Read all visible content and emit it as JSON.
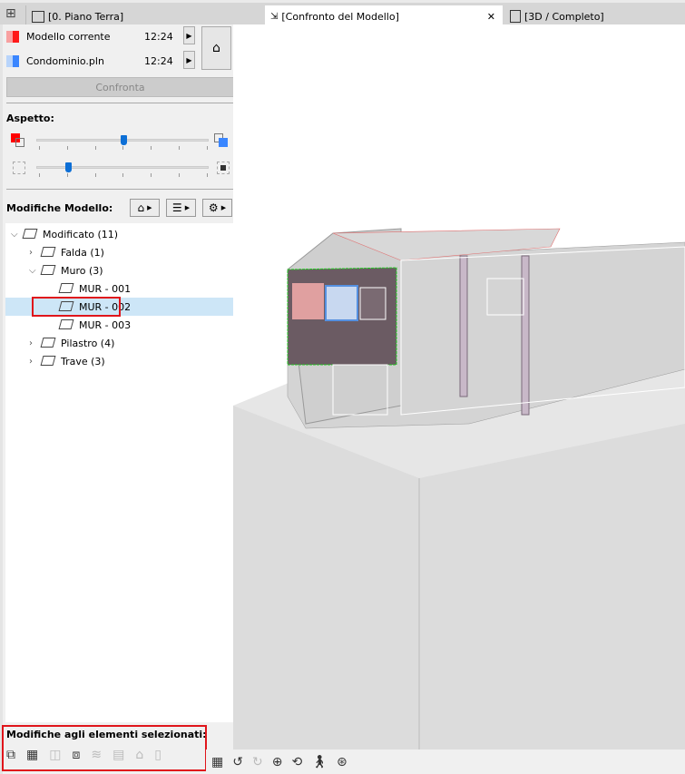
{
  "tabs": [
    {
      "label": "[0. Piano Terra]"
    },
    {
      "label": "[Confronto del Modello]",
      "active": true
    },
    {
      "label": "[3D / Completo]"
    }
  ],
  "models": [
    {
      "name": "Modello corrente",
      "time": "12:24",
      "color": "#ff1a1a"
    },
    {
      "name": "Condominio.pln",
      "time": "12:24",
      "color": "#3a86ff"
    }
  ],
  "compare_button": "Confronta",
  "aspect": {
    "title": "Aspetto:",
    "slider1": 0.5,
    "slider2": 0.17
  },
  "changes": {
    "title": "Modifiche Modello:"
  },
  "tree": [
    {
      "label": "Modificato (11)",
      "level": 0,
      "expanded": true
    },
    {
      "label": "Falda (1)",
      "level": 1
    },
    {
      "label": "Muro (3)",
      "level": 1,
      "expanded": true
    },
    {
      "label": "MUR - 001",
      "level": 2
    },
    {
      "label": "MUR - 002",
      "level": 2,
      "selected": true
    },
    {
      "label": "MUR - 003",
      "level": 2
    },
    {
      "label": "Pilastro (4)",
      "level": 1
    },
    {
      "label": "Trave (3)",
      "level": 1
    }
  ],
  "selected_changes": {
    "title": "Modifiche agli elementi selezionati:"
  }
}
